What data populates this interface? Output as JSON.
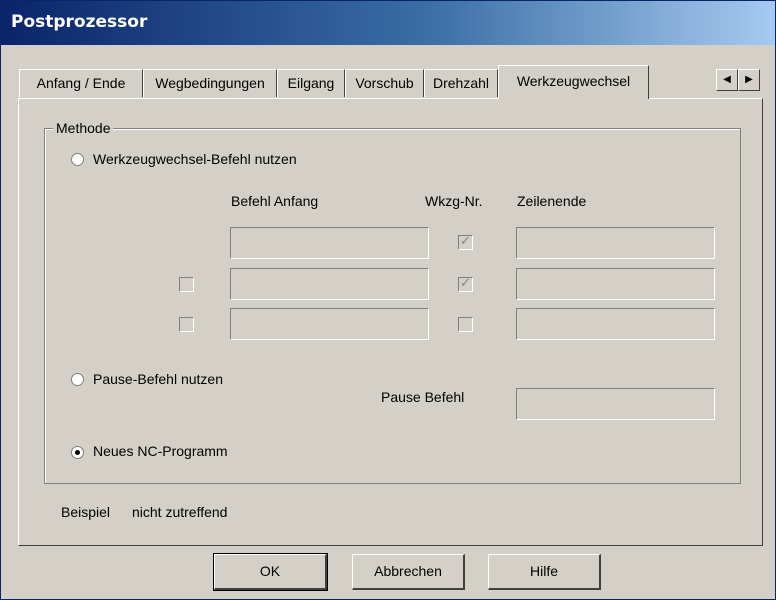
{
  "window": {
    "title": "Postprozessor"
  },
  "tabs": [
    "Anfang / Ende",
    "Wegbedingungen",
    "Eilgang",
    "Vorschub",
    "Drehzahl",
    "Werkzeugwechsel"
  ],
  "active_tab": "Werkzeugwechsel",
  "tab_scroll": {
    "left": "◀",
    "right": "▶"
  },
  "group": {
    "label": "Methode"
  },
  "options": {
    "werkzeugwechsel": "Werkzeugwechsel-Befehl nutzen",
    "pause": "Pause-Befehl nutzen",
    "neues": "Neues NC-Programm",
    "selected": "neues"
  },
  "columns": {
    "befehl_anfang": "Befehl Anfang",
    "wkzg_nr": "Wkzg-Nr.",
    "zeilenende": "Zeilenende"
  },
  "rows": [
    {
      "enabled_checkbox": false,
      "befehl_anfang": "",
      "wkzg_nr": true,
      "zeilenende": ""
    },
    {
      "enabled_checkbox": false,
      "befehl_anfang": "",
      "wkzg_nr": true,
      "zeilenende": ""
    },
    {
      "enabled_checkbox": false,
      "befehl_anfang": "",
      "wkzg_nr": false,
      "zeilenende": ""
    }
  ],
  "pause_befehl": {
    "label": "Pause Befehl",
    "value": ""
  },
  "beispiel": {
    "label": "Beispiel",
    "value": "nicht zutreffend"
  },
  "buttons": {
    "ok": "OK",
    "cancel": "Abbrechen",
    "help": "Hilfe"
  },
  "colors": {
    "face": "#d4d0c8",
    "title_start": "#0a246a",
    "title_end": "#a6caf0"
  }
}
